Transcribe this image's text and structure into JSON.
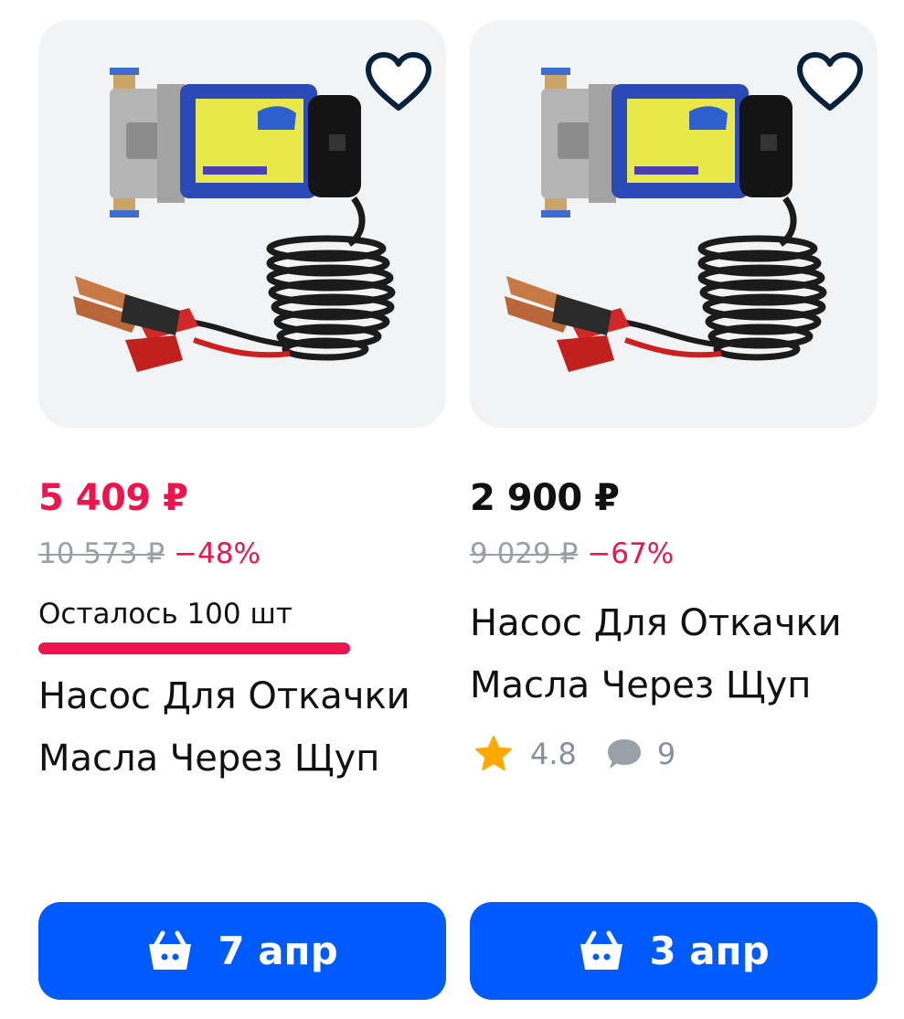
{
  "products": [
    {
      "price": "5 409 ₽",
      "price_color": "#f0134d",
      "old_price": "10 573 ₽",
      "discount": "−48%",
      "stock": "Осталось 100 шт",
      "title": "Насос Для Откачки Масла Через Щуп",
      "delivery": "7 апр",
      "icons": {
        "favorite": "heart-outline-icon",
        "cart": "basket-icon"
      }
    },
    {
      "price": "2 900 ₽",
      "price_color": "#111111",
      "old_price": "9 029 ₽",
      "discount": "−67%",
      "title": "Насос Для Откачки Масла Через Щуп",
      "rating": "4.8",
      "reviews": "9",
      "delivery": "3 апр",
      "icons": {
        "favorite": "heart-outline-icon",
        "rating": "star-icon",
        "reviews": "comment-bubble-icon",
        "cart": "basket-icon"
      }
    }
  ],
  "colors": {
    "accent": "#005bff",
    "sale": "#f0134d",
    "muted": "#9aa0a8",
    "star": "#ffa800"
  }
}
